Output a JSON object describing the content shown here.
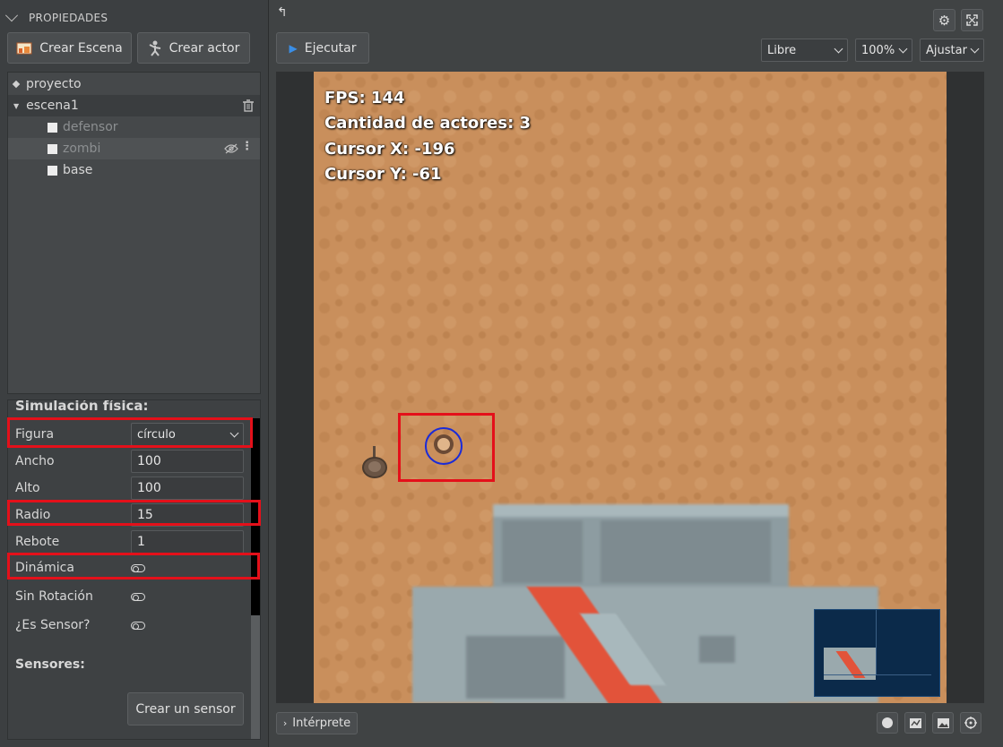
{
  "left_panel": {
    "header": "PROPIEDADES",
    "buttons": {
      "crear_escena": "Crear Escena",
      "crear_actor": "Crear actor"
    },
    "tree": {
      "project": "proyecto",
      "scene": "escena1",
      "actors": [
        {
          "name": "defensor",
          "dimmed": true
        },
        {
          "name": "zombi",
          "dimmed": true
        },
        {
          "name": "base",
          "dimmed": false
        }
      ]
    },
    "physics": {
      "section_title": "Simulación física:",
      "figura_label": "Figura",
      "figura_value": "círculo",
      "ancho_label": "Ancho",
      "ancho_value": "100",
      "alto_label": "Alto",
      "alto_value": "100",
      "radio_label": "Radio",
      "radio_value": "15",
      "rebote_label": "Rebote",
      "rebote_value": "1",
      "dinamica_label": "Dinámica",
      "sin_rotacion_label": "Sin Rotación",
      "es_sensor_label": "¿Es Sensor?",
      "sensores_title": "Sensores:",
      "crear_sensor": "Crear un sensor"
    }
  },
  "toolbar": {
    "ejecutar": "Ejecutar",
    "mode": "Libre",
    "zoom": "100%",
    "fit": "Ajustar"
  },
  "hud": {
    "fps": "FPS: 144",
    "actors": "Cantidad de actores: 3",
    "cursor_x": "Cursor X: -196",
    "cursor_y": "Cursor Y: -61"
  },
  "bottom": {
    "interprete": "Intérprete"
  },
  "colors": {
    "highlight": "#e4101a",
    "sand": "#c98f5c",
    "collider": "#1a2bd8",
    "minimap_bg": "#0b2a4a"
  },
  "icons": [
    "chevron-down-icon",
    "scene-icon",
    "actor-icon",
    "trash-icon",
    "eye-slash-icon",
    "more-icon",
    "undo-icon",
    "gear-icon",
    "fullscreen-icon",
    "play-icon",
    "globe-icon",
    "chart-icon",
    "image-icon",
    "target-icon"
  ]
}
